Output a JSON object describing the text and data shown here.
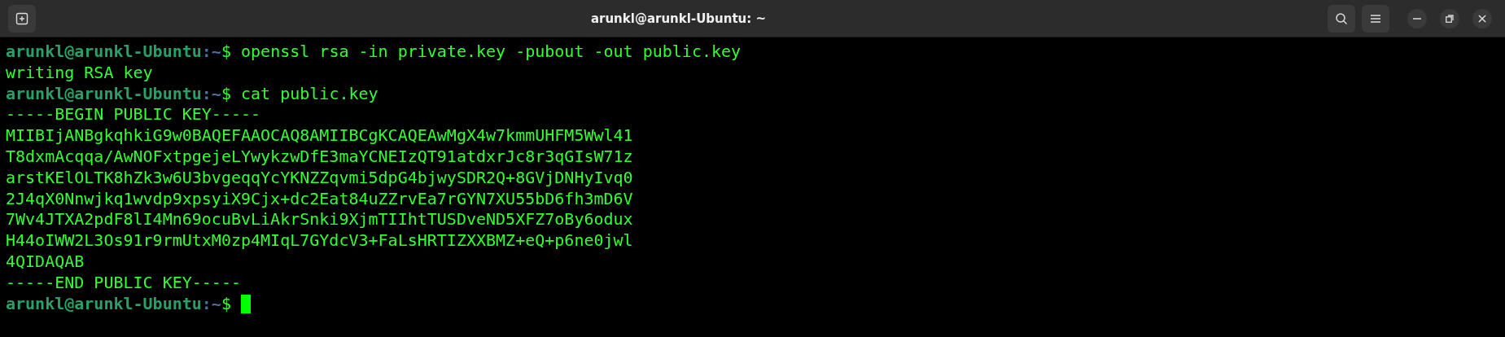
{
  "window": {
    "title": "arunkl@arunkl-Ubuntu: ~"
  },
  "lines": [
    {
      "kind": "prompt",
      "user_host": "arunkl@arunkl-Ubuntu",
      "path": ":~",
      "symbol": "$",
      "command": "openssl rsa -in private.key -pubout -out public.key",
      "cursor": false
    },
    {
      "kind": "output",
      "text": "writing RSA key"
    },
    {
      "kind": "prompt",
      "user_host": "arunkl@arunkl-Ubuntu",
      "path": ":~",
      "symbol": "$",
      "command": "cat public.key",
      "cursor": false
    },
    {
      "kind": "output",
      "text": "-----BEGIN PUBLIC KEY-----"
    },
    {
      "kind": "output",
      "text": "MIIBIjANBgkqhkiG9w0BAQEFAAOCAQ8AMIIBCgKCAQEAwMgX4w7kmmUHFM5Wwl41"
    },
    {
      "kind": "output",
      "text": "T8dxmAcqqa/AwNOFxtpgejeLYwykzwDfE3maYCNEIzQT91atdxrJc8r3qGIsW71z"
    },
    {
      "kind": "output",
      "text": "arstKElOLTK8hZk3w6U3bvgeqqYcYKNZZqvmi5dpG4bjwySDR2Q+8GVjDNHyIvq0"
    },
    {
      "kind": "output",
      "text": "2J4qX0Nnwjkq1wvdp9xpsyiX9Cjx+dc2Eat84uZZrvEa7rGYN7XU55bD6fh3mD6V"
    },
    {
      "kind": "output",
      "text": "7Wv4JTXA2pdF8lI4Mn69ocuBvLiAkrSnki9XjmTIIhtTUSDveND5XFZ7oBy6odux"
    },
    {
      "kind": "output",
      "text": "H44oIWW2L3Os91r9rmUtxM0zp4MIqL7GYdcV3+FaLsHRTIZXXBMZ+eQ+p6ne0jwl"
    },
    {
      "kind": "output",
      "text": "4QIDAQAB"
    },
    {
      "kind": "output",
      "text": "-----END PUBLIC KEY-----"
    },
    {
      "kind": "prompt",
      "user_host": "arunkl@arunkl-Ubuntu",
      "path": ":~",
      "symbol": "$",
      "cursor": true
    }
  ]
}
